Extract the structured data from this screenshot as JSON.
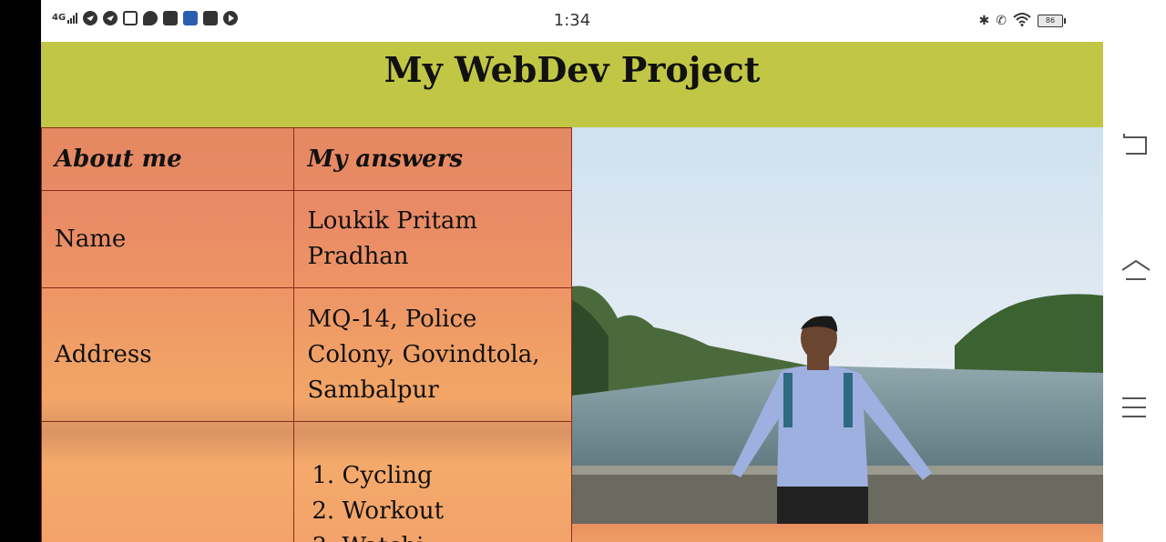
{
  "status_bar": {
    "network": "4G",
    "time": "1:34",
    "battery": "86",
    "notification_icons": [
      "navigation-icon",
      "telegram-icon",
      "instagram-icon",
      "chat-icon",
      "mail-icon",
      "id-card-icon",
      "paytm-icon",
      "youtube-icon"
    ],
    "right_icons": [
      "bluetooth-icon",
      "call-icon",
      "wifi-icon",
      "battery-icon"
    ]
  },
  "page": {
    "title": "My WebDev Project"
  },
  "about_table": {
    "headers": [
      "About me",
      "My answers"
    ],
    "rows": [
      {
        "label": "Name",
        "value": "Loukik Pritam Pradhan"
      },
      {
        "label": "Address",
        "value": "MQ-14, Police Colony, Govindtola, Sambalpur"
      }
    ],
    "hobbies": [
      "Cycling",
      "Workout",
      "Watchi"
    ]
  },
  "photo": {
    "subject": "person-by-river-photo"
  },
  "nav_bar": {
    "buttons": [
      "back-icon",
      "home-icon",
      "menu-icon"
    ]
  },
  "colors": {
    "header_bg": "#c1c744",
    "table_border": "#8b2a1c",
    "table_bg": "#e98a66"
  }
}
